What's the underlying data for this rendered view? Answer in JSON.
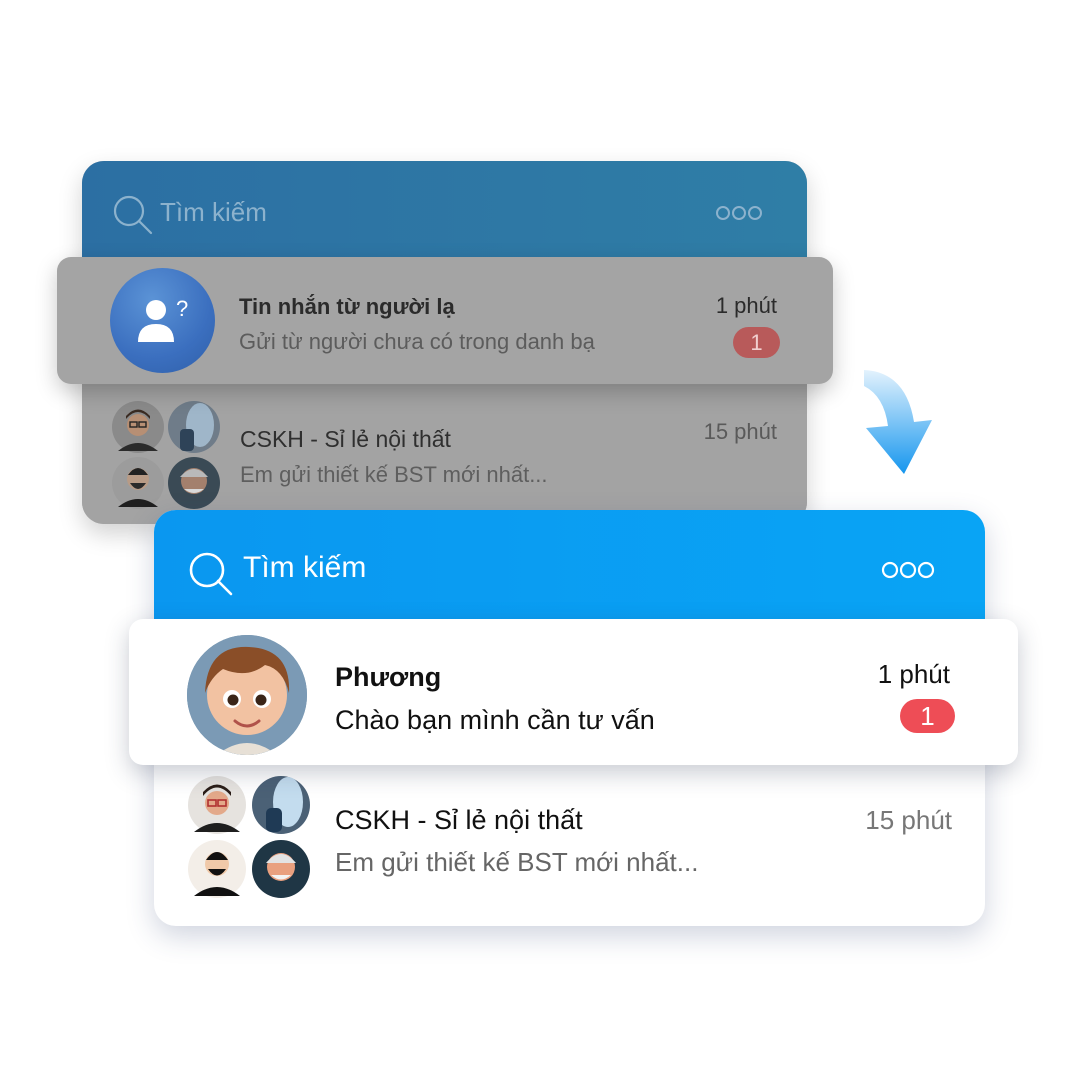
{
  "colors": {
    "front_header": "#0a97f0",
    "back_header": "#2c6fa3",
    "badge_front": "#ee4d56",
    "badge_back": "#b85a5a",
    "arrow": "#1e9cf0"
  },
  "before": {
    "search": {
      "label": "Tìm kiếm",
      "icon": "search-icon"
    },
    "more_icon": "more-icon",
    "highlighted_chat": {
      "name": "Tin nhắn từ người lạ",
      "preview": "Gửi từ người chưa có trong danh bạ",
      "time": "1 phút",
      "unread": "1",
      "avatar_icon": "unknown-user-icon"
    },
    "chat": {
      "name": "CSKH - Sỉ lẻ nội thất",
      "preview": "Em gửi thiết kế BST mới nhất...",
      "time": "15 phút"
    }
  },
  "after": {
    "search": {
      "label": "Tìm kiếm",
      "icon": "search-icon"
    },
    "more_icon": "more-icon",
    "highlighted_chat": {
      "name": "Phương",
      "preview": "Chào bạn mình cần tư vấn",
      "time": "1 phút",
      "unread": "1"
    },
    "chat": {
      "name": "CSKH - Sỉ lẻ nội thất",
      "preview": "Em gửi thiết kế BST mới nhất...",
      "time": "15 phút"
    }
  }
}
